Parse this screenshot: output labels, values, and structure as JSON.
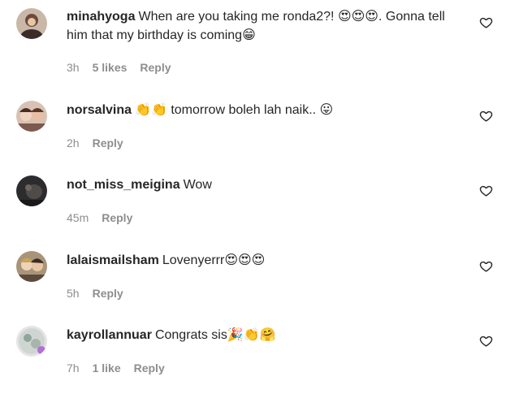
{
  "comments": [
    {
      "username": "minahyoga",
      "text": "When are you taking me ronda2?! 😍😍😍. Gonna tell him that my birthday is coming😁",
      "time": "3h",
      "likes": "5 likes",
      "reply": "Reply"
    },
    {
      "username": "norsalvina",
      "text": "👏👏 tomorrow boleh lah naik.. 😛",
      "time": "2h",
      "likes": "",
      "reply": "Reply"
    },
    {
      "username": "not_miss_meigina",
      "text": "Wow",
      "time": "45m",
      "likes": "",
      "reply": "Reply"
    },
    {
      "username": "lalaismailsham",
      "text": "Lovenyerrr😍😍😍",
      "time": "5h",
      "likes": "",
      "reply": "Reply"
    },
    {
      "username": "kayrollannuar",
      "text": "Congrats sis🎉👏🤗",
      "time": "7h",
      "likes": "1 like",
      "reply": "Reply"
    }
  ],
  "colors": {
    "text": "#262626",
    "secondary": "#8e8e8e",
    "background": "#ffffff"
  },
  "icons": {
    "like": "heart-outline-icon"
  }
}
